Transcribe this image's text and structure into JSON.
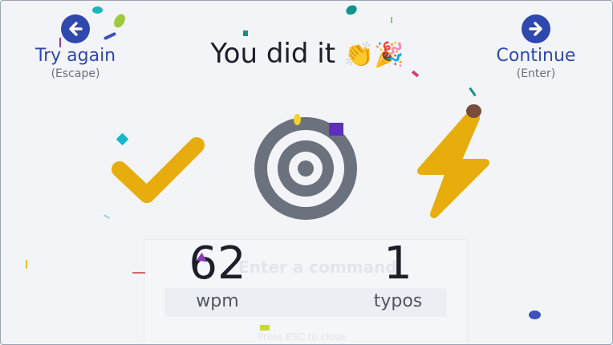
{
  "title": {
    "text": "You did it",
    "emoji": "👏🎉"
  },
  "nav": {
    "back": {
      "label": "Try again",
      "hint": "(Escape)",
      "icon": "arrow-left-icon"
    },
    "forward": {
      "label": "Continue",
      "hint": "(Enter)",
      "icon": "arrow-right-icon"
    }
  },
  "icons": {
    "accuracy": "checkmark-icon",
    "target": "target-icon",
    "speed": "lightning-icon"
  },
  "stats": {
    "wpm": {
      "value": "62",
      "label": "wpm"
    },
    "typos": {
      "value": "1",
      "label": "typos"
    }
  },
  "background": {
    "command_placeholder": "Enter a command",
    "hint": "Press ESC to close"
  },
  "colors": {
    "accent": "#2f48ae",
    "gold": "#e6ad0d",
    "target_gray": "#6c717e",
    "text": "#1c1f27"
  }
}
